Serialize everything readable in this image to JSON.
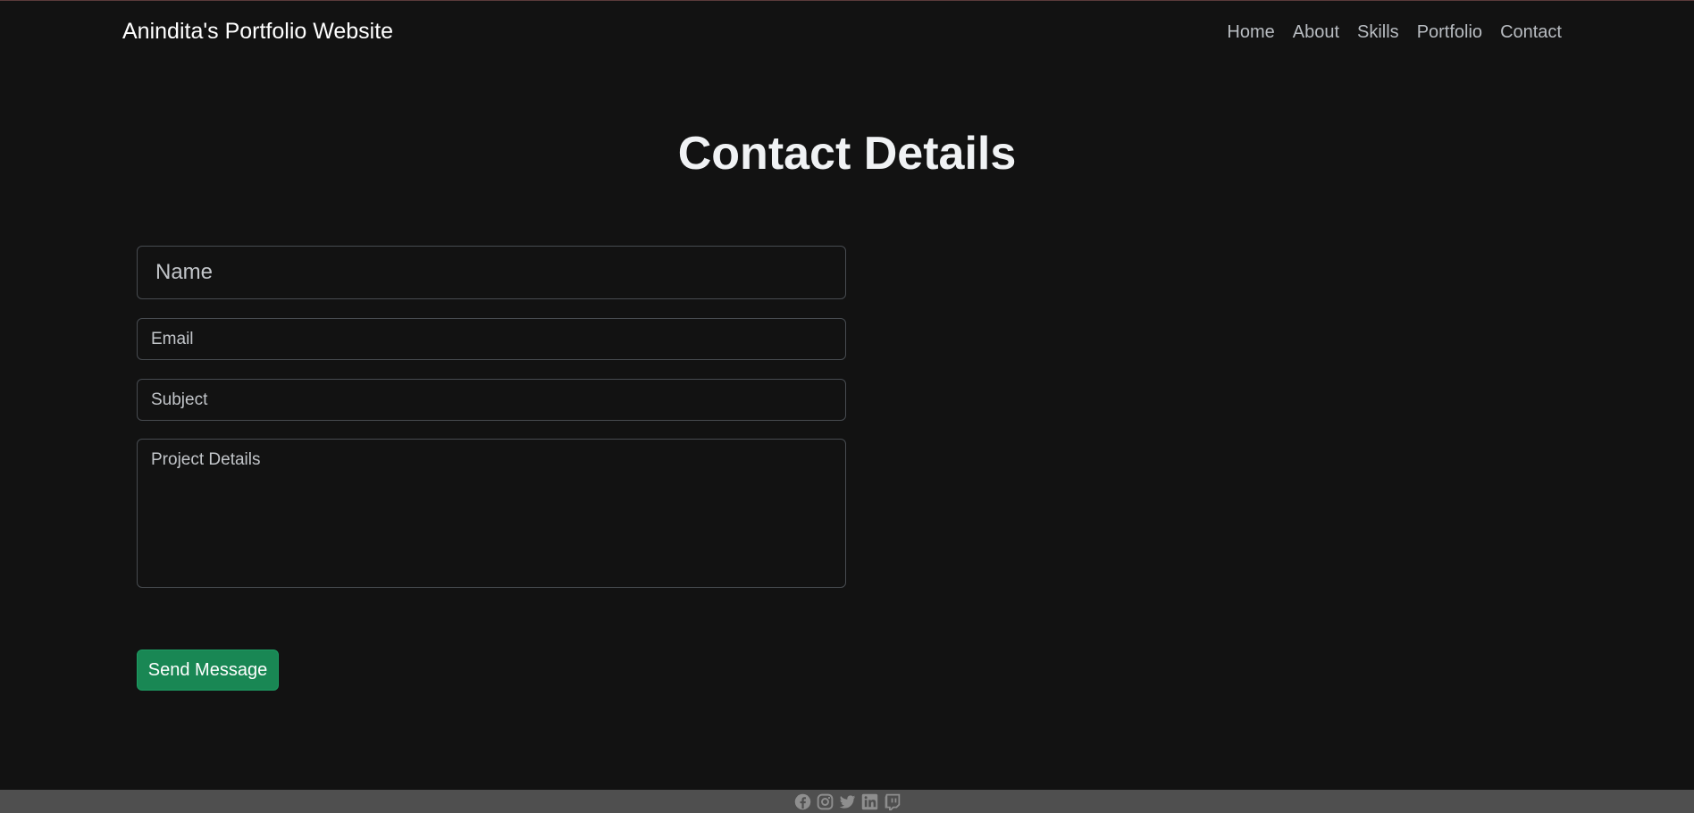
{
  "navbar": {
    "brand": "Anindita's Portfolio Website",
    "links": [
      "Home",
      "About",
      "Skills",
      "Portfolio",
      "Contact"
    ]
  },
  "contact": {
    "title": "Contact Details",
    "name_placeholder": "Name",
    "email_placeholder": "Email",
    "subject_placeholder": "Subject",
    "details_placeholder": "Project Details",
    "submit_label": "Send Message"
  },
  "footer": {
    "social_icons": [
      "facebook-icon",
      "instagram-icon",
      "twitter-icon",
      "linkedin-icon",
      "twitch-icon"
    ]
  },
  "colors": {
    "background": "#121212",
    "button": "#198754",
    "footer": "#4f4f4f"
  }
}
